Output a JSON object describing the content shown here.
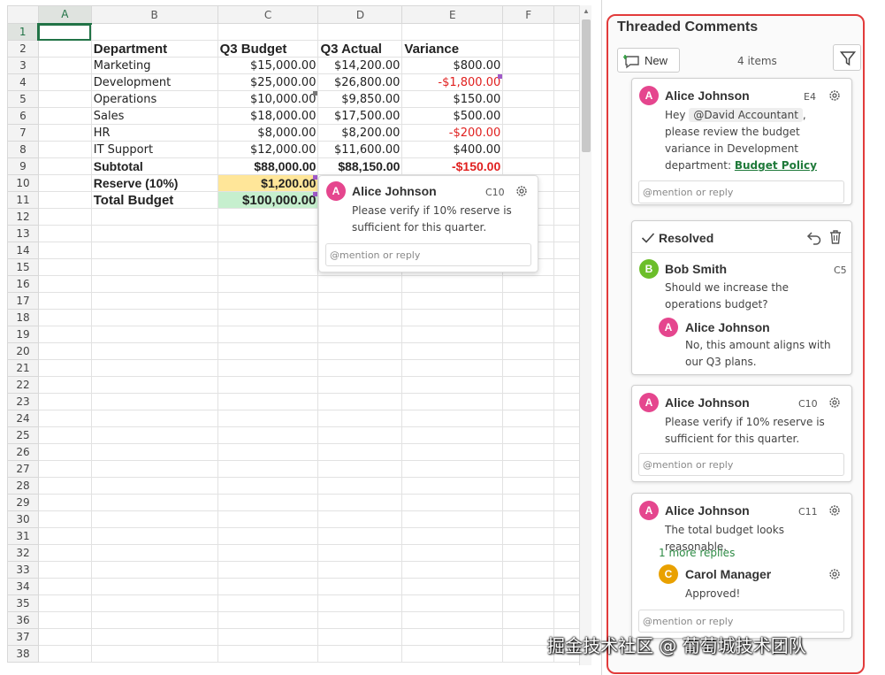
{
  "sheet": {
    "columns": [
      "A",
      "B",
      "C",
      "D",
      "E",
      "F"
    ],
    "row_numbers": [
      "1",
      "2",
      "3",
      "4",
      "5",
      "6",
      "7",
      "8",
      "9",
      "10",
      "11",
      "12",
      "13",
      "14",
      "15",
      "16",
      "17",
      "18",
      "19",
      "20",
      "21",
      "22",
      "23",
      "24",
      "25",
      "26",
      "27",
      "28",
      "29",
      "30",
      "31",
      "32",
      "33",
      "34",
      "35",
      "36",
      "37",
      "38"
    ],
    "header": {
      "department": "Department",
      "budget": "Q3 Budget",
      "actual": "Q3 Actual",
      "variance": "Variance"
    },
    "rows": [
      {
        "name": "Marketing",
        "budget": "$15,000.00",
        "actual": "$14,200.00",
        "variance": "$800.00"
      },
      {
        "name": "Development",
        "budget": "$25,000.00",
        "actual": "$26,800.00",
        "variance": "-$1,800.00"
      },
      {
        "name": "Operations",
        "budget": "$10,000.00",
        "actual": "$9,850.00",
        "variance": "$150.00"
      },
      {
        "name": "Sales",
        "budget": "$18,000.00",
        "actual": "$17,500.00",
        "variance": "$500.00"
      },
      {
        "name": "HR",
        "budget": "$8,000.00",
        "actual": "$8,200.00",
        "variance": "-$200.00"
      },
      {
        "name": "IT Support",
        "budget": "$12,000.00",
        "actual": "$11,600.00",
        "variance": "$400.00"
      }
    ],
    "subtotal": {
      "label": "Subtotal",
      "budget": "$88,000.00",
      "actual": "$88,150.00",
      "variance": "-$150.00"
    },
    "reserve": {
      "label": "Reserve (10%)",
      "value": "$1,200.00"
    },
    "total": {
      "label": "Total Budget",
      "value": "$100,000.00"
    }
  },
  "hover_comment": {
    "avatar": "A",
    "author": "Alice Johnson",
    "cell": "C10",
    "text": "Please verify if 10% reserve is sufficient for this quarter.",
    "reply_placeholder": "@mention or reply"
  },
  "panel": {
    "title": "Threaded Comments",
    "new_label": "New",
    "count": "4 items",
    "threads": [
      {
        "avatar": "A",
        "author": "Alice Johnson",
        "cell": "E4",
        "text_prefix": "Hey ",
        "mention": "@David Accountant",
        "text_body": ", please review the budget variance in Development department: ",
        "link": "Budget Policy",
        "reply_placeholder": "@mention or reply"
      },
      {
        "status": "Resolved",
        "avatar": "B",
        "author": "Bob Smith",
        "cell": "C5",
        "text": "Should we increase the operations budget?",
        "reply": {
          "avatar": "A",
          "author": "Alice Johnson",
          "text": "No, this amount aligns with our Q3 plans."
        }
      },
      {
        "avatar": "A",
        "author": "Alice Johnson",
        "cell": "C10",
        "text": "Please verify if 10% reserve is sufficient for this quarter.",
        "reply_placeholder": "@mention or reply"
      },
      {
        "avatar": "A",
        "author": "Alice Johnson",
        "cell": "C11",
        "text": "The total budget looks reasonable.",
        "more_replies": "1 more replies",
        "reply": {
          "avatar": "C",
          "author": "Carol Manager",
          "text": "Approved!"
        },
        "reply_placeholder": "@mention or reply"
      }
    ]
  },
  "colors": {
    "accent": "#217346",
    "panel_border": "#e23b3b",
    "negative": "#e0201f",
    "reserve_fill": "#ffe699",
    "total_fill": "#c6efce",
    "avatar_a": "#e5468e",
    "avatar_b": "#6cbe2a",
    "avatar_c": "#e9a100"
  },
  "watermark": "掘金技术社区 @ 葡萄城技术团队"
}
